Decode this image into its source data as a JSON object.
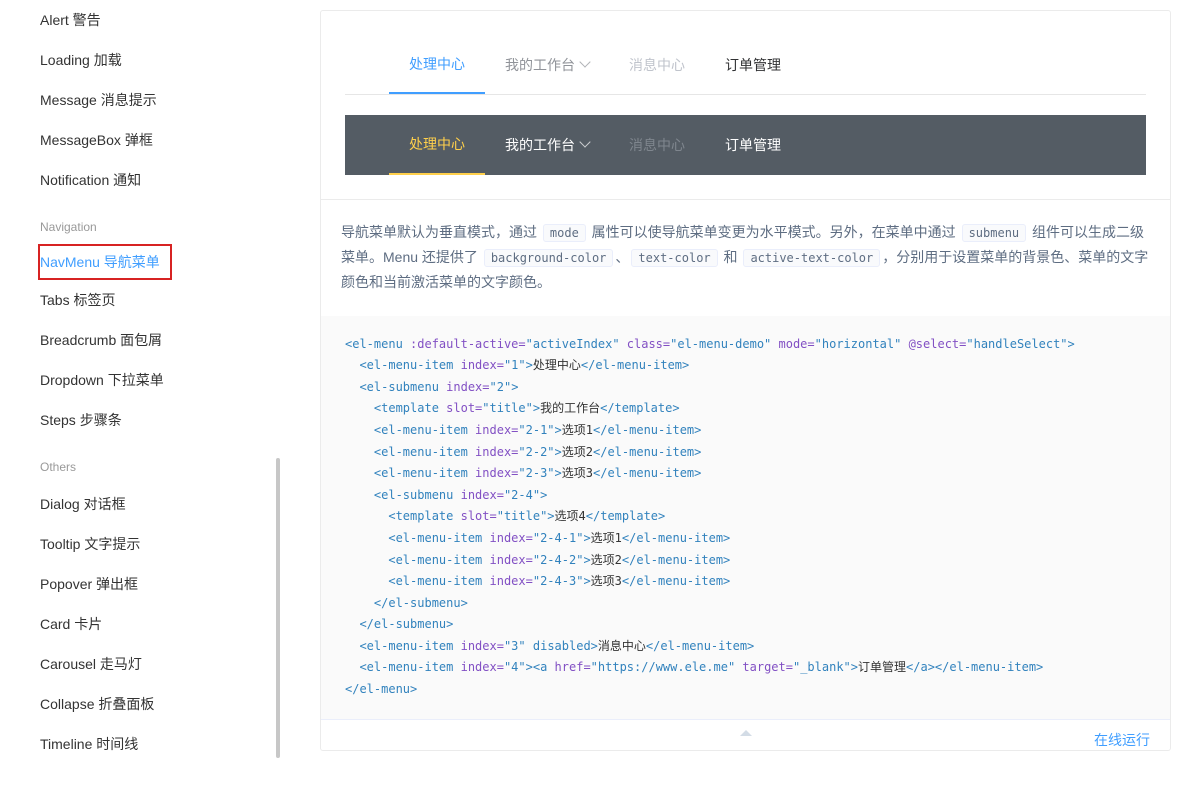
{
  "sidebar": {
    "items_top": [
      {
        "label": "Alert 警告"
      },
      {
        "label": "Loading 加载"
      },
      {
        "label": "Message 消息提示"
      },
      {
        "label": "MessageBox 弹框"
      },
      {
        "label": "Notification 通知"
      }
    ],
    "group_nav": "Navigation",
    "items_nav": [
      {
        "label": "NavMenu 导航菜单",
        "active": true
      },
      {
        "label": "Tabs 标签页"
      },
      {
        "label": "Breadcrumb 面包屑"
      },
      {
        "label": "Dropdown 下拉菜单"
      },
      {
        "label": "Steps 步骤条"
      }
    ],
    "group_others": "Others",
    "items_others": [
      {
        "label": "Dialog 对话框"
      },
      {
        "label": "Tooltip 文字提示"
      },
      {
        "label": "Popover 弹出框"
      },
      {
        "label": "Card 卡片"
      },
      {
        "label": "Carousel 走马灯"
      },
      {
        "label": "Collapse 折叠面板"
      },
      {
        "label": "Timeline 时间线"
      }
    ]
  },
  "menu": {
    "item1": "处理中心",
    "item2": "我的工作台",
    "item3": "消息中心",
    "item4": "订单管理"
  },
  "desc": {
    "t1": "导航菜单默认为垂直模式，通过 ",
    "c1": "mode",
    "t2": " 属性可以使导航菜单变更为水平模式。另外，在菜单中通过 ",
    "c2": "submenu",
    "t3": " 组件可以生成二级菜单。Menu 还提供了 ",
    "c3": "background-color",
    "t4": "、",
    "c4": "text-color",
    "t5": " 和 ",
    "c5": "active-text-color",
    "t6": "，分别用于设置菜单的背景色、菜单的文字颜色和当前激活菜单的文字颜色。"
  },
  "code": {
    "l1a": "<el-menu ",
    "l1b": ":default-active=",
    "l1c": "\"activeIndex\"",
    "l1d": " class=",
    "l1e": "\"el-menu-demo\"",
    "l1f": " mode=",
    "l1g": "\"horizontal\"",
    "l1h": " @select=",
    "l1i": "\"handleSelect\"",
    "l1j": ">",
    "l2a": "  <el-menu-item ",
    "l2b": "index=",
    "l2c": "\"1\"",
    "l2d": ">",
    "l2e": "处理中心",
    "l2f": "</el-menu-item>",
    "l3a": "  <el-submenu ",
    "l3b": "index=",
    "l3c": "\"2\"",
    "l3d": ">",
    "l4a": "    <template ",
    "l4b": "slot=",
    "l4c": "\"title\"",
    "l4d": ">",
    "l4e": "我的工作台",
    "l4f": "</template>",
    "l5a": "    <el-menu-item ",
    "l5b": "index=",
    "l5c": "\"2-1\"",
    "l5d": ">",
    "l5e": "选项1",
    "l5f": "</el-menu-item>",
    "l6a": "    <el-menu-item ",
    "l6b": "index=",
    "l6c": "\"2-2\"",
    "l6d": ">",
    "l6e": "选项2",
    "l6f": "</el-menu-item>",
    "l7a": "    <el-menu-item ",
    "l7b": "index=",
    "l7c": "\"2-3\"",
    "l7d": ">",
    "l7e": "选项3",
    "l7f": "</el-menu-item>",
    "l8a": "    <el-submenu ",
    "l8b": "index=",
    "l8c": "\"2-4\"",
    "l8d": ">",
    "l9a": "      <template ",
    "l9b": "slot=",
    "l9c": "\"title\"",
    "l9d": ">",
    "l9e": "选项4",
    "l9f": "</template>",
    "l10a": "      <el-menu-item ",
    "l10b": "index=",
    "l10c": "\"2-4-1\"",
    "l10d": ">",
    "l10e": "选项1",
    "l10f": "</el-menu-item>",
    "l11a": "      <el-menu-item ",
    "l11b": "index=",
    "l11c": "\"2-4-2\"",
    "l11d": ">",
    "l11e": "选项2",
    "l11f": "</el-menu-item>",
    "l12a": "      <el-menu-item ",
    "l12b": "index=",
    "l12c": "\"2-4-3\"",
    "l12d": ">",
    "l12e": "选项3",
    "l12f": "</el-menu-item>",
    "l13": "    </el-submenu>",
    "l14": "  </el-submenu>",
    "l15a": "  <el-menu-item ",
    "l15b": "index=",
    "l15c": "\"3\"",
    "l15d": " disabled>",
    "l15e": "消息中心",
    "l15f": "</el-menu-item>",
    "l16a": "  <el-menu-item ",
    "l16b": "index=",
    "l16c": "\"4\"",
    "l16d": "><a ",
    "l16e": "href=",
    "l16f": "\"https://www.ele.me\"",
    "l16g": " target=",
    "l16h": "\"_blank\"",
    "l16i": ">",
    "l16j": "订单管理",
    "l16k": "</a></el-menu-item>",
    "l17": "</el-menu>"
  },
  "run": {
    "label": "在线运行"
  }
}
